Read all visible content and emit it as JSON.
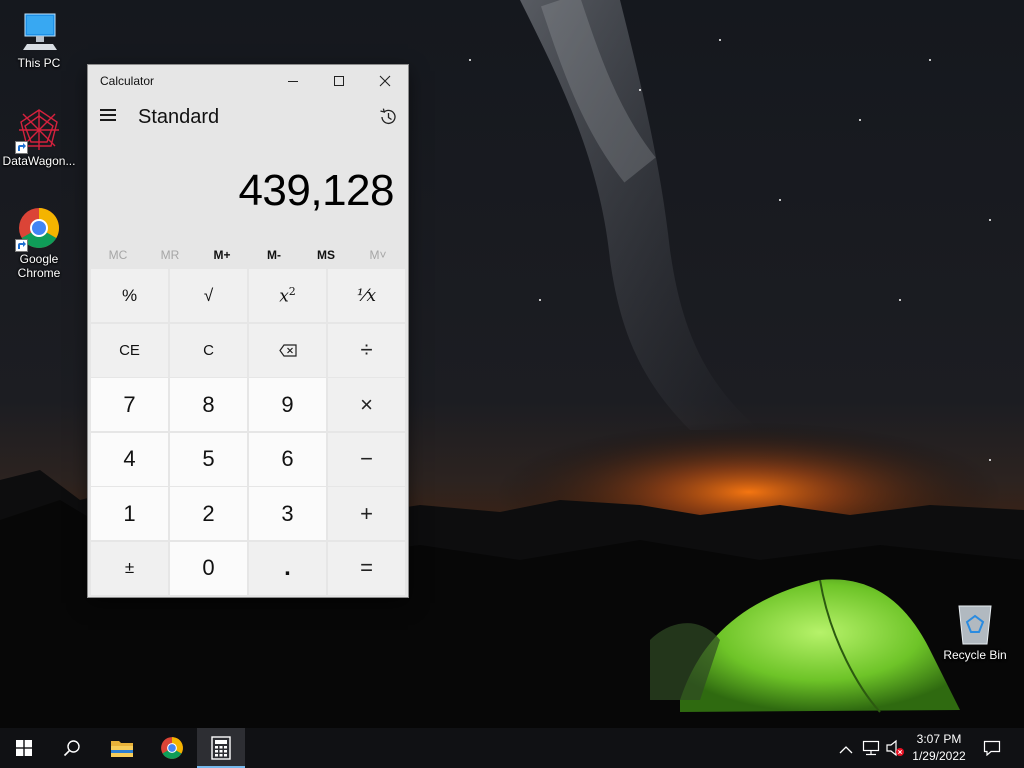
{
  "desktop": {
    "icons": [
      {
        "label": "This PC"
      },
      {
        "label": "DataWagon..."
      },
      {
        "label": "Google\nChrome"
      },
      {
        "label": "Recycle Bin"
      }
    ]
  },
  "calculator": {
    "window_title": "Calculator",
    "mode": "Standard",
    "display_value": "439,128",
    "memory_buttons": [
      {
        "label": "MC",
        "enabled": false
      },
      {
        "label": "MR",
        "enabled": false
      },
      {
        "label": "M+",
        "enabled": true
      },
      {
        "label": "M-",
        "enabled": true
      },
      {
        "label": "MS",
        "enabled": true
      },
      {
        "label": "M˅",
        "enabled": false
      }
    ],
    "keys": {
      "percent": "%",
      "sqrt": "√",
      "square_base": "x",
      "square_exp": "2",
      "reciprocal": "⅟x",
      "ce": "CE",
      "c": "C",
      "divide": "÷",
      "seven": "7",
      "eight": "8",
      "nine": "9",
      "multiply": "×",
      "four": "4",
      "five": "5",
      "six": "6",
      "minus": "−",
      "one": "1",
      "two": "2",
      "three": "3",
      "plus": "+",
      "negate": "±",
      "zero": "0",
      "decimal": ".",
      "equals": "="
    }
  },
  "taskbar": {
    "clock_time": "3:07 PM",
    "clock_date": "1/29/2022",
    "active_app": "Calculator"
  },
  "colors": {
    "taskbar_bg": "#101114",
    "calc_bg": "#e6e6e6",
    "digit_key_bg": "#fbfbfb",
    "accent": "#76b9ed"
  }
}
